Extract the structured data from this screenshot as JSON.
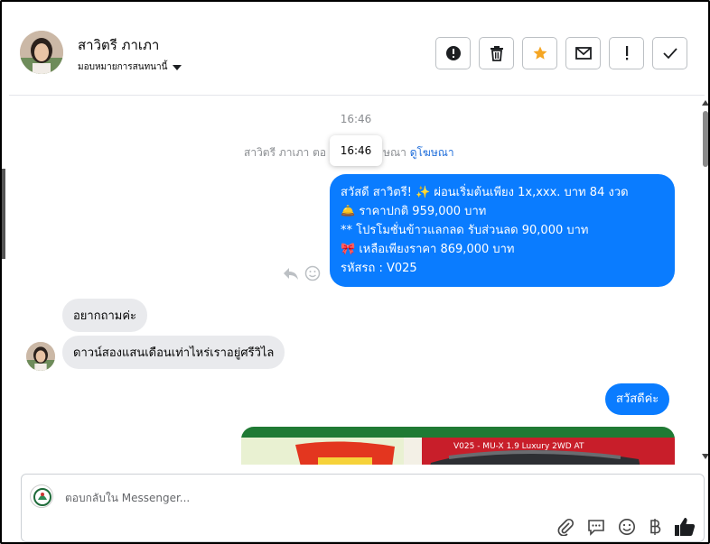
{
  "header": {
    "contact_name": "สาวิตรี ภาเภา",
    "assign_label": "มอบหมายการสนทนานี้",
    "actions": [
      {
        "name": "mark-spam-button",
        "icon": "alert-circle-icon"
      },
      {
        "name": "delete-button",
        "icon": "trash-icon"
      },
      {
        "name": "star-button",
        "icon": "star-icon"
      },
      {
        "name": "mark-unread-button",
        "icon": "envelope-icon"
      },
      {
        "name": "follow-up-button",
        "icon": "exclamation-icon"
      },
      {
        "name": "mark-done-button",
        "icon": "check-icon"
      }
    ]
  },
  "conversation": {
    "timestamp": "16:46",
    "ad_prefix": "สาวิตรี ภาเภา ตอ",
    "ad_suffix": "ษณา",
    "ad_link": "ดูโฆษณา",
    "tooltip_time": "16:46",
    "promo_lines": [
      "สวัสดี สาวิตรี! ✨  ผ่อนเริ่มต้นเพียง 1x,xxx. บาท 84 งวด",
      "🛎️ ราคาปกติ 959,000 บาท",
      "** โปรโมชั่นข้าวแลกลด รับส่วนลด 90,000 บาท",
      "🎀  เหลือเพียงราคา 869,000 บาท",
      " รหัสรถ : V025"
    ],
    "incoming": [
      "อยากถามค่ะ",
      "ดาวน์สองแสนเดือนเท่าไหร่เราอยู่ศรีวิไล"
    ],
    "outgoing_reply": "สวัสดีค่ะ",
    "image_caption": "V025 - MU-X 1.9 Luxury 2WD AT"
  },
  "composer": {
    "placeholder": "ตอบกลับใน Messenger...",
    "tools": [
      "paperclip-icon",
      "saved-reply-icon",
      "emoji-icon",
      "baht-icon",
      "thumbs-up-icon"
    ]
  },
  "colors": {
    "outgoing_bubble": "#0a7cff",
    "incoming_bubble": "#e9eaed",
    "star": "#f5a623"
  }
}
